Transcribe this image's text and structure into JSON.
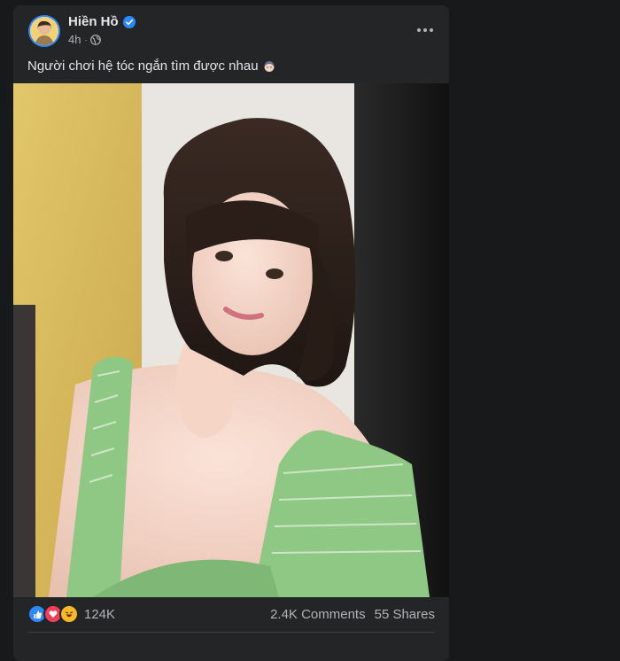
{
  "post": {
    "author": "Hiền Hồ",
    "time": "4h",
    "caption": "Người chơi hệ tóc ngắn tìm được nhau",
    "icons": {
      "verified": "verified-badge-icon",
      "audience": "globe-icon",
      "more": "more-options-icon",
      "caption_emoji": "woman-face-emoji-icon"
    }
  },
  "stats": {
    "reaction_count": "124K",
    "comments": "2.4K Comments",
    "shares": "55 Shares",
    "reaction_icons": [
      "like-icon",
      "love-icon",
      "haha-icon"
    ]
  },
  "colors": {
    "background": "#18191a",
    "card": "#242526",
    "text_primary": "#e4e6eb",
    "text_secondary": "#b0b3b8",
    "accent": "#2d88ff"
  }
}
